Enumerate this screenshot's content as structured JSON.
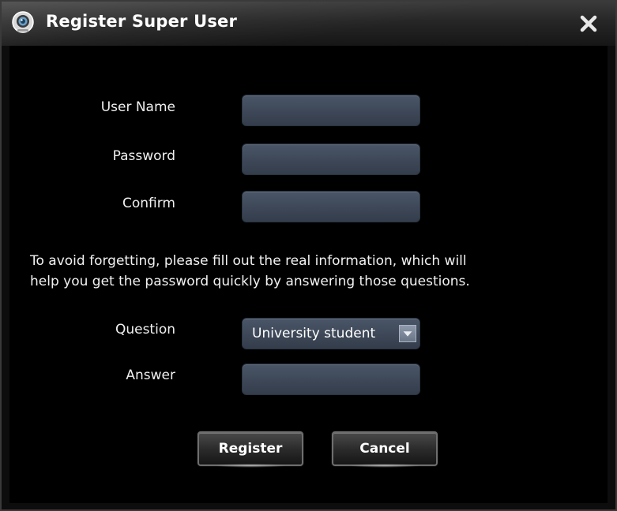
{
  "window": {
    "title": "Register Super User",
    "app_icon": "camera-icon",
    "close_icon": "close-icon"
  },
  "form": {
    "user_name_label": "User Name",
    "user_name_value": "",
    "password_label": "Password",
    "password_value": "",
    "confirm_label": "Confirm",
    "confirm_value": "",
    "notice_line1": "To avoid forgetting, please fill out the real information, which will",
    "notice_line2": "help you get the password quickly by answering those questions.",
    "question_label": "Question",
    "question_selected": "University student",
    "answer_label": "Answer",
    "answer_value": ""
  },
  "buttons": {
    "register_label": "Register",
    "cancel_label": "Cancel"
  },
  "colors": {
    "background": "#000000",
    "field": "#3d4757",
    "text": "#ffffff"
  }
}
